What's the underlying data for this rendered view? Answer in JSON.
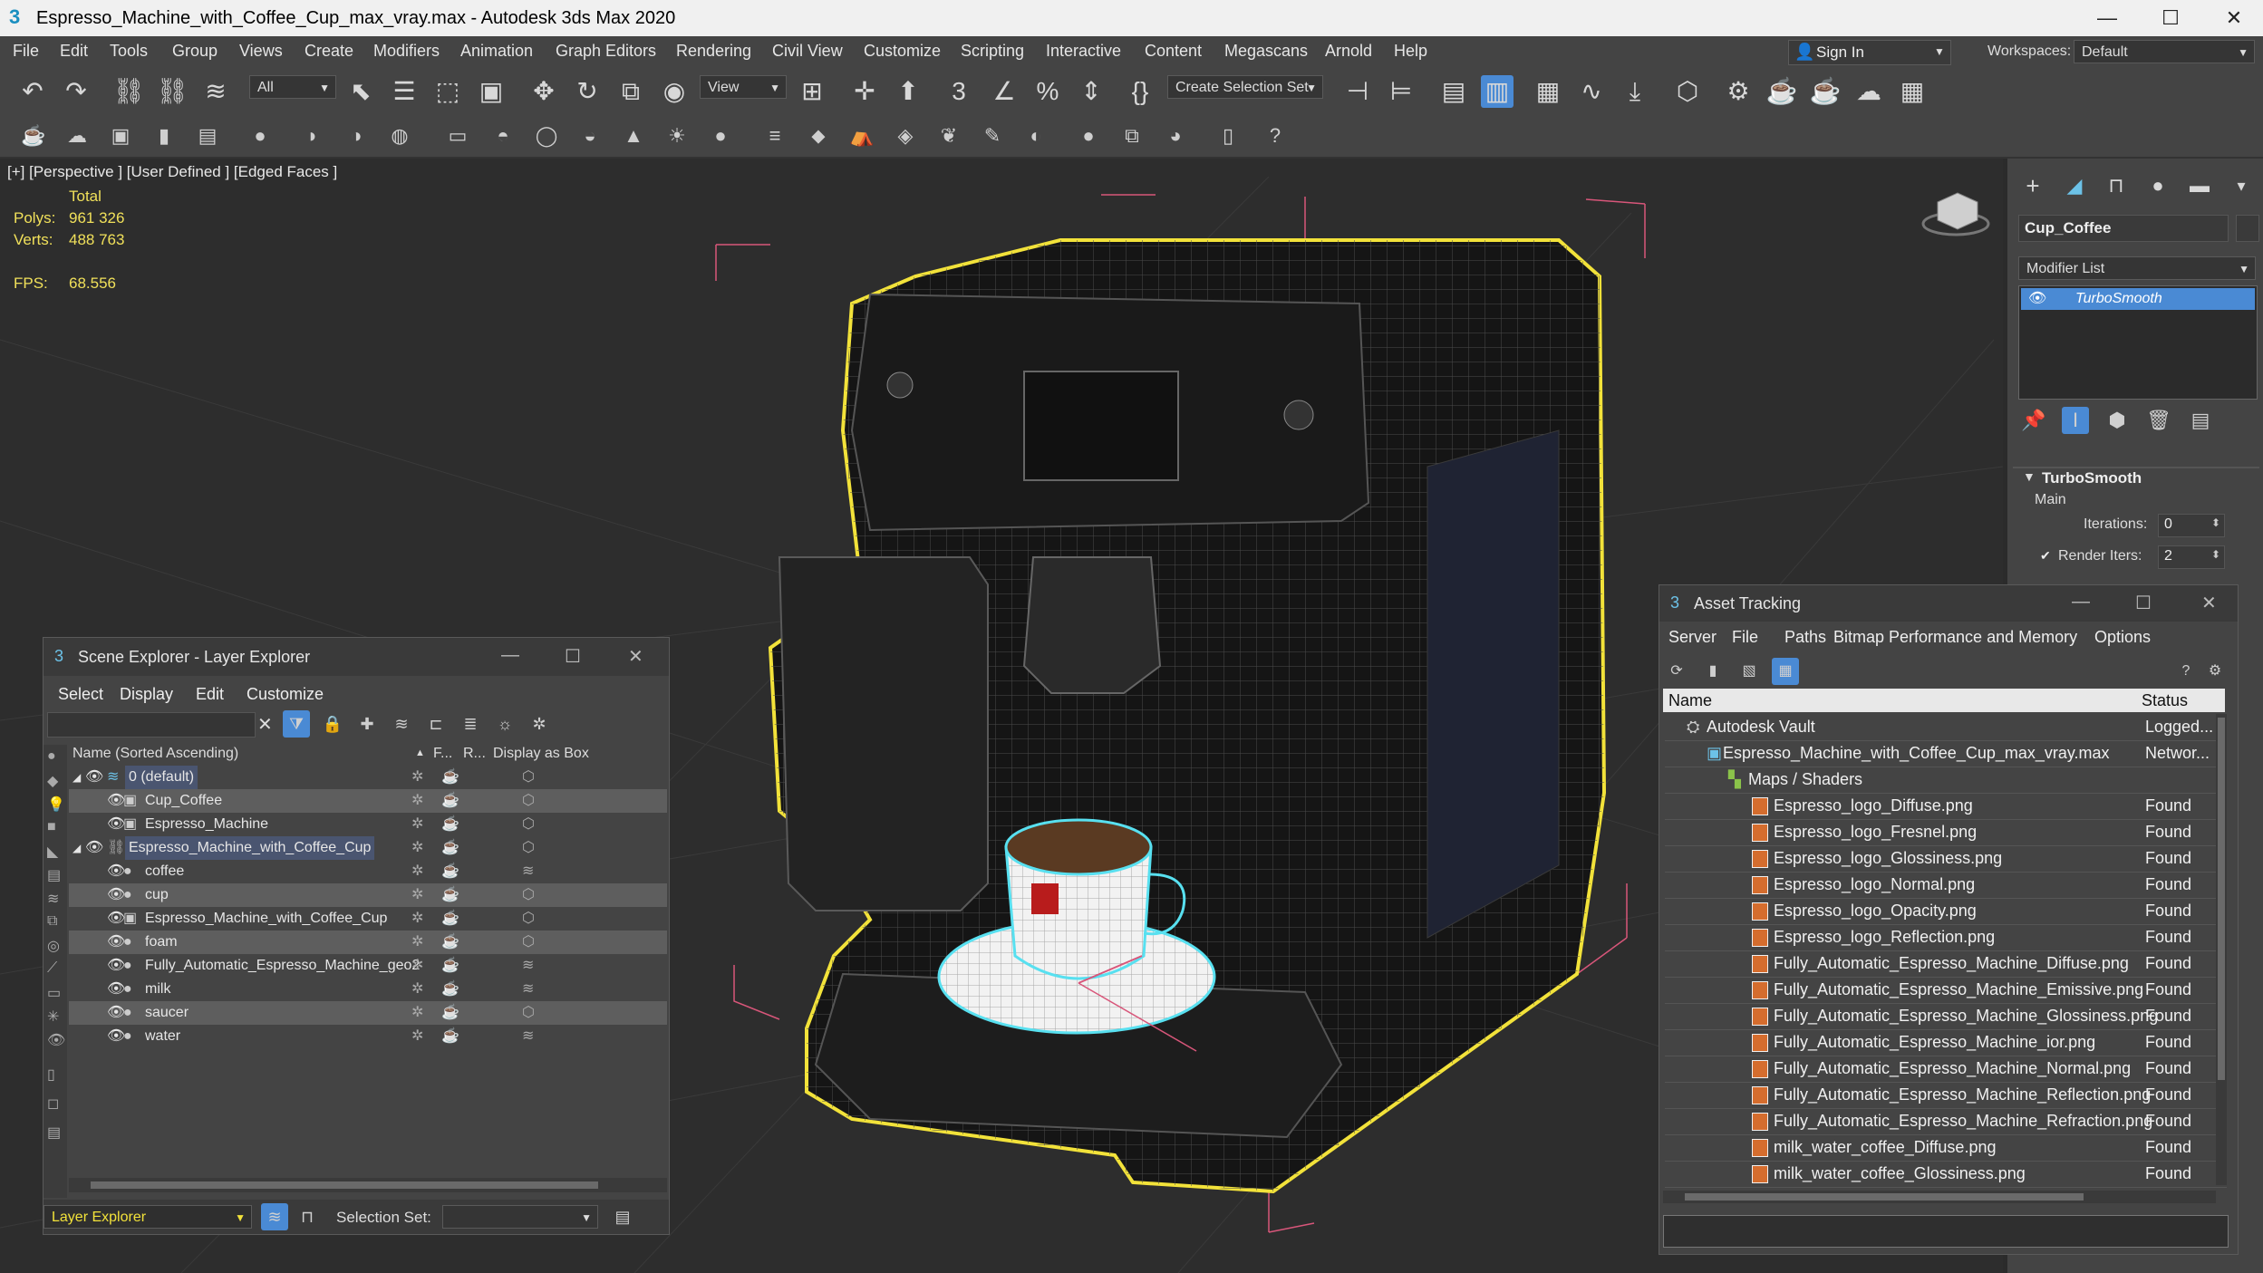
{
  "window": {
    "title": "Espresso_Machine_with_Coffee_Cup_max_vray.max - Autodesk 3ds Max 2020",
    "app_icon": "3",
    "minimize": "—",
    "maximize": "☐",
    "close": "✕"
  },
  "menu": [
    "File",
    "Edit",
    "Tools",
    "Group",
    "Views",
    "Create",
    "Modifiers",
    "Animation",
    "Graph Editors",
    "Rendering",
    "Civil View",
    "Customize",
    "Scripting",
    "Interactive",
    "Content",
    "Megascans",
    "Arnold",
    "Help"
  ],
  "account": {
    "sign_in": "Sign In",
    "workspaces_label": "Workspaces:",
    "workspace_value": "Default"
  },
  "toolbar": {
    "filter_value": "All",
    "ref_coord_value": "View",
    "selection_set_placeholder": "Create Selection Set"
  },
  "viewport": {
    "label": "[+] [Perspective ] [User Defined ] [Edged Faces ]",
    "stats": {
      "total_label": "Total",
      "polys_label": "Polys:",
      "polys_value": "961 326",
      "verts_label": "Verts:",
      "verts_value": "488 763",
      "fps_label": "FPS:",
      "fps_value": "68.556"
    }
  },
  "command_panel": {
    "object_name": "Cup_Coffee",
    "modifier_list": "Modifier List",
    "modifier_stack_item": "TurboSmooth",
    "rollout_title": "TurboSmooth",
    "section": "Main",
    "iterations_label": "Iterations:",
    "iterations_value": "0",
    "render_iters_label": "Render Iters:",
    "render_iters_value": "2"
  },
  "scene_explorer": {
    "title": "Scene Explorer - Layer Explorer",
    "menu": [
      "Select",
      "Display",
      "Edit",
      "Customize"
    ],
    "columns": {
      "name": "Name (Sorted Ascending)",
      "freeze": "F...",
      "render": "R...",
      "display_box": "Display as Box"
    },
    "rows": [
      {
        "label": "0 (default)",
        "level": 0,
        "type": "layer"
      },
      {
        "label": "Cup_Coffee",
        "level": 1,
        "type": "obj"
      },
      {
        "label": "Espresso_Machine",
        "level": 1,
        "type": "obj"
      },
      {
        "label": "Espresso_Machine_with_Coffee_Cup",
        "level": 0,
        "type": "layer"
      },
      {
        "label": "coffee",
        "level": 1,
        "type": "obj"
      },
      {
        "label": "cup",
        "level": 1,
        "type": "obj"
      },
      {
        "label": "Espresso_Machine_with_Coffee_Cup",
        "level": 1,
        "type": "obj"
      },
      {
        "label": "foam",
        "level": 1,
        "type": "obj"
      },
      {
        "label": "Fully_Automatic_Espresso_Machine_geo2",
        "level": 1,
        "type": "obj"
      },
      {
        "label": "milk",
        "level": 1,
        "type": "obj"
      },
      {
        "label": "saucer",
        "level": 1,
        "type": "obj"
      },
      {
        "label": "water",
        "level": 1,
        "type": "obj"
      }
    ],
    "footer_mode": "Layer Explorer",
    "selection_set_label": "Selection Set:"
  },
  "asset_tracking": {
    "title": "Asset Tracking",
    "menu": [
      "Server",
      "File",
      "Paths",
      "Bitmap Performance and Memory",
      "Options"
    ],
    "columns": {
      "name": "Name",
      "status": "Status"
    },
    "rows": [
      {
        "name": "Autodesk Vault",
        "status": "Logged...",
        "level": 0
      },
      {
        "name": "Espresso_Machine_with_Coffee_Cup_max_vray.max",
        "status": "Networ...",
        "level": 1
      },
      {
        "name": "Maps / Shaders",
        "status": "",
        "level": 2
      },
      {
        "name": "Espresso_logo_Diffuse.png",
        "status": "Found",
        "level": 3
      },
      {
        "name": "Espresso_logo_Fresnel.png",
        "status": "Found",
        "level": 3
      },
      {
        "name": "Espresso_logo_Glossiness.png",
        "status": "Found",
        "level": 3
      },
      {
        "name": "Espresso_logo_Normal.png",
        "status": "Found",
        "level": 3
      },
      {
        "name": "Espresso_logo_Opacity.png",
        "status": "Found",
        "level": 3
      },
      {
        "name": "Espresso_logo_Reflection.png",
        "status": "Found",
        "level": 3
      },
      {
        "name": "Fully_Automatic_Espresso_Machine_Diffuse.png",
        "status": "Found",
        "level": 3
      },
      {
        "name": "Fully_Automatic_Espresso_Machine_Emissive.png",
        "status": "Found",
        "level": 3
      },
      {
        "name": "Fully_Automatic_Espresso_Machine_Glossiness.png",
        "status": "Found",
        "level": 3
      },
      {
        "name": "Fully_Automatic_Espresso_Machine_ior.png",
        "status": "Found",
        "level": 3
      },
      {
        "name": "Fully_Automatic_Espresso_Machine_Normal.png",
        "status": "Found",
        "level": 3
      },
      {
        "name": "Fully_Automatic_Espresso_Machine_Reflection.png",
        "status": "Found",
        "level": 3
      },
      {
        "name": "Fully_Automatic_Espresso_Machine_Refraction.png",
        "status": "Found",
        "level": 3
      },
      {
        "name": "milk_water_coffee_Diffuse.png",
        "status": "Found",
        "level": 3
      },
      {
        "name": "milk_water_coffee_Glossiness.png",
        "status": "Found",
        "level": 3
      }
    ]
  },
  "colors": {
    "selection_outline": "#f2e23a",
    "cup_outline": "#58e0f0",
    "bbox": "#d8567a",
    "accent": "#4a8ad4"
  }
}
